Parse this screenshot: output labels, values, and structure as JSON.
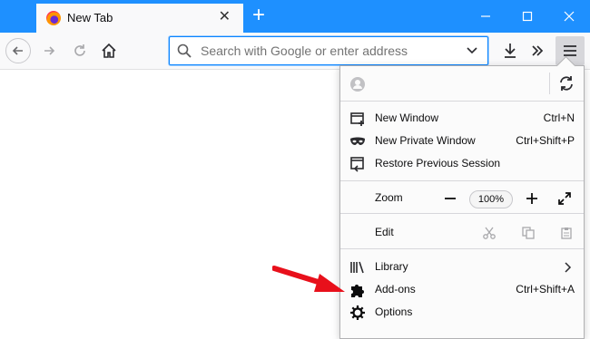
{
  "browser": {
    "tab": {
      "title": "New Tab"
    },
    "urlbar": {
      "placeholder": "Search with Google or enter address"
    }
  },
  "menu": {
    "items": [
      {
        "label": "New Window",
        "shortcut": "Ctrl+N",
        "icon": "new-window-icon"
      },
      {
        "label": "New Private Window",
        "shortcut": "Ctrl+Shift+P",
        "icon": "private-mask-icon"
      },
      {
        "label": "Restore Previous Session",
        "shortcut": "",
        "icon": "restore-session-icon"
      }
    ],
    "zoom": {
      "label": "Zoom",
      "value": "100%"
    },
    "edit": {
      "label": "Edit"
    },
    "library": {
      "label": "Library"
    },
    "addons": {
      "label": "Add-ons",
      "shortcut": "Ctrl+Shift+A"
    },
    "options": {
      "label": "Options"
    }
  },
  "colors": {
    "accent": "#0a84ff",
    "titlebar": "#1e90ff",
    "arrow": "#e8101b"
  }
}
